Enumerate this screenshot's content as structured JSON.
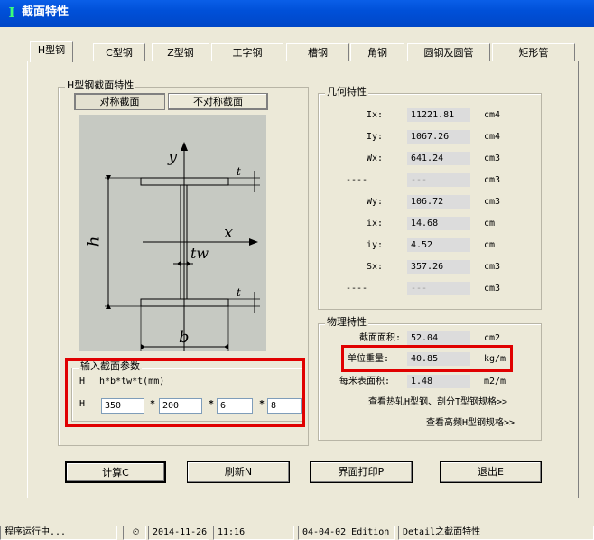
{
  "window": {
    "title": "截面特性"
  },
  "tabs": [
    {
      "label": "H型钢"
    },
    {
      "label": "C型钢"
    },
    {
      "label": "Z型钢"
    },
    {
      "label": "工字钢"
    },
    {
      "label": "槽钢"
    },
    {
      "label": "角钢"
    },
    {
      "label": "圆钢及圆管"
    },
    {
      "label": "矩形管"
    }
  ],
  "left": {
    "group_title": "H型钢截面特性",
    "sym_button": "对称截面",
    "asym_button": "不对称截面",
    "diagram": {
      "y": "y",
      "x": "x",
      "h": "h",
      "b": "b",
      "tw": "tw",
      "t": "t"
    },
    "input_group_title": "输入截面参数",
    "formula_prefix": "H",
    "formula": "h*b*tw*t(mm)",
    "row_prefix": "H",
    "inputs": [
      "350",
      "200",
      "6",
      "8"
    ],
    "sep": "*"
  },
  "geometry": {
    "title": "几何特性",
    "rows": [
      {
        "label": "Ix:",
        "value": "11221.81",
        "unit": "cm4"
      },
      {
        "label": "Iy:",
        "value": "1067.26",
        "unit": "cm4"
      },
      {
        "label": "Wx:",
        "value": "641.24",
        "unit": "cm3"
      },
      {
        "label": "----",
        "value": "---",
        "unit": "cm3"
      },
      {
        "label": "Wy:",
        "value": "106.72",
        "unit": "cm3"
      },
      {
        "label": "ix:",
        "value": "14.68",
        "unit": "cm"
      },
      {
        "label": "iy:",
        "value": "4.52",
        "unit": "cm"
      },
      {
        "label": "Sx:",
        "value": "357.26",
        "unit": "cm3"
      },
      {
        "label": "----",
        "value": "---",
        "unit": "cm3"
      }
    ]
  },
  "physical": {
    "title": "物理特性",
    "rows": [
      {
        "label": "截面面积:",
        "value": "52.04",
        "unit": "cm2"
      },
      {
        "label": "单位重量:",
        "value": "40.85",
        "unit": "kg/m"
      },
      {
        "label": "每米表面积:",
        "value": "1.48",
        "unit": "m2/m"
      }
    ],
    "link1": "查看热轧H型钢、剖分T型钢规格>>",
    "link2": "查看高频H型钢规格>>"
  },
  "buttons": {
    "calc": "计算C",
    "refresh": "刷新N",
    "print": "界面打印P",
    "exit": "退出E"
  },
  "status": {
    "running": "程序运行中...",
    "date": "2014-11-26",
    "time": "11:16",
    "edition": "04-04-02 Edition",
    "module": "Detail之截面特性"
  },
  "colors": {
    "title_bar": "#0050d8",
    "highlight": "#e00000",
    "diagram_bg": "#c6c9c2"
  }
}
